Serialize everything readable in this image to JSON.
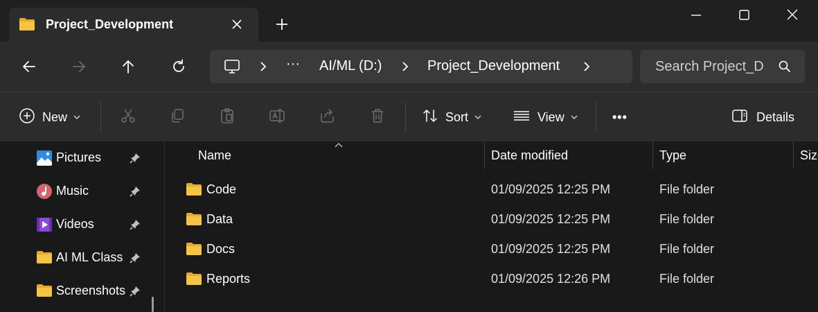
{
  "window": {
    "tab_title": "Project_Development",
    "tab_icon": "folder-icon",
    "new_tab_icon": "plus-icon"
  },
  "navigation": {
    "back_icon": "back-arrow-icon",
    "forward_icon": "forward-arrow-icon",
    "up_icon": "up-arrow-icon",
    "refresh_icon": "refresh-icon"
  },
  "address_bar": {
    "root_icon": "this-pc-icon",
    "ellipsis": "···",
    "crumbs": [
      "AI/ML (D:)",
      "Project_Development"
    ]
  },
  "search": {
    "text": "Search Project_D"
  },
  "toolbar": {
    "new_label": "New",
    "sort_label": "Sort",
    "view_label": "View",
    "more_label": "•••",
    "details_label": "Details"
  },
  "sidebar": {
    "items": [
      {
        "label": "Pictures",
        "icon": "pictures-icon"
      },
      {
        "label": "Music",
        "icon": "music-icon"
      },
      {
        "label": "Videos",
        "icon": "videos-icon"
      },
      {
        "label": "AI ML Class",
        "icon": "folder-icon"
      },
      {
        "label": "Screenshots",
        "icon": "folder-icon"
      }
    ]
  },
  "columns": {
    "name": "Name",
    "date": "Date modified",
    "type": "Type",
    "size": "Size"
  },
  "files": [
    {
      "name": "Code",
      "date": "01/09/2025 12:25 PM",
      "type": "File folder"
    },
    {
      "name": "Data",
      "date": "01/09/2025 12:25 PM",
      "type": "File folder"
    },
    {
      "name": "Docs",
      "date": "01/09/2025 12:25 PM",
      "type": "File folder"
    },
    {
      "name": "Reports",
      "date": "01/09/2025 12:26 PM",
      "type": "File folder"
    }
  ],
  "colors": {
    "folder": "#f5c542",
    "background": "#191919",
    "chrome": "#2c2c2c"
  }
}
